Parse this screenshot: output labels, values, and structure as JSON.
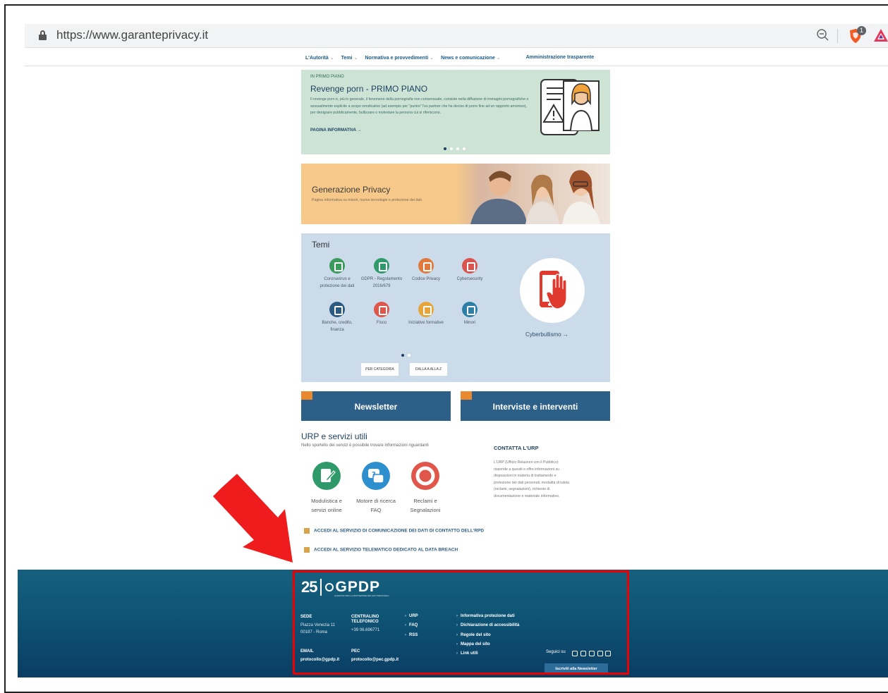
{
  "browser": {
    "url": "https://www.garanteprivacy.it",
    "badge_count": "1"
  },
  "nav": {
    "items": [
      "L'Autorità",
      "Temi",
      "Normativa e provvedimenti",
      "News e comunicazione"
    ],
    "amministrazione": "Amministrazione trasparente"
  },
  "hero": {
    "kicker": "IN PRIMO PIANO",
    "title": "Revenge porn - PRIMO PIANO",
    "description": "Il revenge porn è, più in generale, il fenomeno della pornografia non consensuale, consiste nella diffusione di immagini pornografiche o sessualmente esplicite a scopo vendicativo (ad esempio per \"punire\" l'ex partner che ha deciso di porre fine ad un rapporto amoroso), per denigrare pubblicamente, bullizzare o molestare la persona cui si riferiscono.",
    "more_link": "PAGINA INFORMATIVA →"
  },
  "generazione": {
    "title": "Generazione Privacy",
    "subtitle": "Pagina informativa su minori, nuove tecnologie e protezione dei dati"
  },
  "temi": {
    "title": "Temi",
    "items": [
      {
        "label": "Coronavirus e protezione dei dati",
        "color": "#3a9b5c"
      },
      {
        "label": "GDPR - Regolamento 2016/679",
        "color": "#2e9a6a"
      },
      {
        "label": "Codice Privacy",
        "color": "#e07a3f"
      },
      {
        "label": "Cybersecurity",
        "color": "#d9534f"
      },
      {
        "label": "Banche, credito, finanza",
        "color": "#2d5a80"
      },
      {
        "label": "Fisco",
        "color": "#e0564a"
      },
      {
        "label": "Iniziative formative",
        "color": "#e5a53a"
      },
      {
        "label": "Minori",
        "color": "#2e7fa6"
      }
    ],
    "cyber_link": "Cyberbullismo →",
    "btn_categoria": "PER CATEGORIA",
    "btn_az": "DALLA A ALLA Z"
  },
  "boxes": {
    "newsletter": "Newsletter",
    "interviste": "Interviste e interventi"
  },
  "urp": {
    "title": "URP e servizi utili",
    "subtitle": "Nello sportello dei servizi è possibile trovare informazioni riguardanti",
    "items": [
      {
        "line1": "Modulistica e",
        "line2": "servizi online",
        "color": "#2e9a6a"
      },
      {
        "line1": "Motore di ricerca",
        "line2": "FAQ",
        "color": "#2e8fcf"
      },
      {
        "line1": "Reclami e",
        "line2": "Segnalazioni",
        "color": "#e0564a"
      }
    ],
    "contatta_title": "CONTATTA L'URP",
    "contatta_text": "L'URP (Ufficio Relazioni con il Pubblico) risponde a quesiti e offre informazioni su disposizioni in materia di trattamento e protezione dei dati personali, modalità di tutela (reclami, segnalazioni), richieste di documentazione e materiale informativo."
  },
  "access": {
    "rpd": "ACCEDI AL SERVIZIO DI COMUNICAZIONE DEI DATI DI CONTATTO DELL'RPD",
    "breach": "ACCEDI AL SERVIZIO TELEMATICO DEDICATO AL DATA BREACH"
  },
  "footer": {
    "logo_number": "25",
    "logo_text": "GPDP",
    "logo_tagline": "GARANTE PER LA PROTEZIONE DEI DATI PERSONALI",
    "sede_h": "SEDE",
    "sede_l1": "Piazza Venezia 11",
    "sede_l2": "00187 - Roma",
    "centralino_h1": "CENTRALINO",
    "centralino_h2": "TELEFONICO",
    "centralino_v": "+39 06.696771",
    "email_h": "EMAIL",
    "email_v": "protocollo@gpdp.it",
    "pec_h": "PEC",
    "pec_v": "protocollo@pec.gpdp.it",
    "links_a": [
      "URP",
      "FAQ",
      "RSS"
    ],
    "links_b": [
      "Informativa protezione dati",
      "Dichiarazione di accessibilità",
      "Regole del sito",
      "Mappa del sito",
      "Link utili"
    ],
    "seguici": "Seguici su",
    "iscriviti": "Iscriviti alla Newsletter"
  }
}
